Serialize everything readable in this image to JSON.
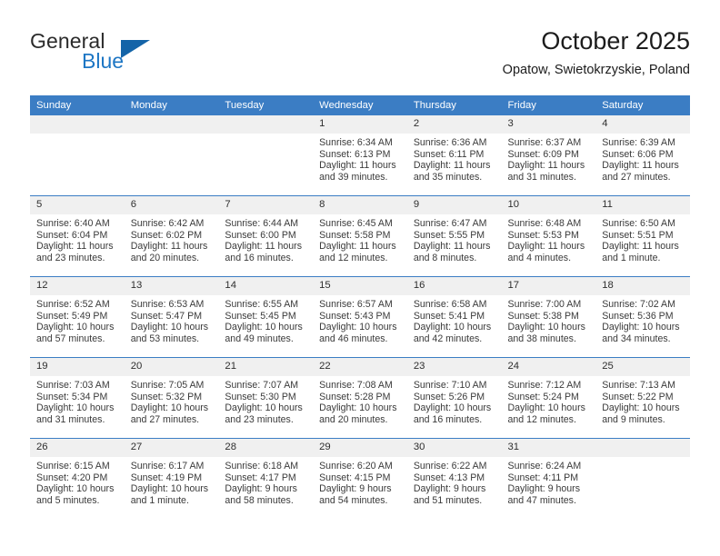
{
  "brand": {
    "name_part1": "General",
    "name_part2": "Blue",
    "accent_color": "#1d76c4",
    "logo_icon": "triangle-flag-icon"
  },
  "header": {
    "title": "October 2025",
    "location": "Opatow, Swietokrzyskie, Poland"
  },
  "calendar": {
    "header_bg": "#3b7dc4",
    "daynum_bg": "#f0f0f0",
    "weekday_headers": [
      "Sunday",
      "Monday",
      "Tuesday",
      "Wednesday",
      "Thursday",
      "Friday",
      "Saturday"
    ],
    "weeks": [
      [
        {
          "day": "",
          "empty": true
        },
        {
          "day": "",
          "empty": true
        },
        {
          "day": "",
          "empty": true
        },
        {
          "day": "1",
          "sunrise": "Sunrise: 6:34 AM",
          "sunset": "Sunset: 6:13 PM",
          "daylight1": "Daylight: 11 hours",
          "daylight2": "and 39 minutes."
        },
        {
          "day": "2",
          "sunrise": "Sunrise: 6:36 AM",
          "sunset": "Sunset: 6:11 PM",
          "daylight1": "Daylight: 11 hours",
          "daylight2": "and 35 minutes."
        },
        {
          "day": "3",
          "sunrise": "Sunrise: 6:37 AM",
          "sunset": "Sunset: 6:09 PM",
          "daylight1": "Daylight: 11 hours",
          "daylight2": "and 31 minutes."
        },
        {
          "day": "4",
          "sunrise": "Sunrise: 6:39 AM",
          "sunset": "Sunset: 6:06 PM",
          "daylight1": "Daylight: 11 hours",
          "daylight2": "and 27 minutes."
        }
      ],
      [
        {
          "day": "5",
          "sunrise": "Sunrise: 6:40 AM",
          "sunset": "Sunset: 6:04 PM",
          "daylight1": "Daylight: 11 hours",
          "daylight2": "and 23 minutes."
        },
        {
          "day": "6",
          "sunrise": "Sunrise: 6:42 AM",
          "sunset": "Sunset: 6:02 PM",
          "daylight1": "Daylight: 11 hours",
          "daylight2": "and 20 minutes."
        },
        {
          "day": "7",
          "sunrise": "Sunrise: 6:44 AM",
          "sunset": "Sunset: 6:00 PM",
          "daylight1": "Daylight: 11 hours",
          "daylight2": "and 16 minutes."
        },
        {
          "day": "8",
          "sunrise": "Sunrise: 6:45 AM",
          "sunset": "Sunset: 5:58 PM",
          "daylight1": "Daylight: 11 hours",
          "daylight2": "and 12 minutes."
        },
        {
          "day": "9",
          "sunrise": "Sunrise: 6:47 AM",
          "sunset": "Sunset: 5:55 PM",
          "daylight1": "Daylight: 11 hours",
          "daylight2": "and 8 minutes."
        },
        {
          "day": "10",
          "sunrise": "Sunrise: 6:48 AM",
          "sunset": "Sunset: 5:53 PM",
          "daylight1": "Daylight: 11 hours",
          "daylight2": "and 4 minutes."
        },
        {
          "day": "11",
          "sunrise": "Sunrise: 6:50 AM",
          "sunset": "Sunset: 5:51 PM",
          "daylight1": "Daylight: 11 hours",
          "daylight2": "and 1 minute."
        }
      ],
      [
        {
          "day": "12",
          "sunrise": "Sunrise: 6:52 AM",
          "sunset": "Sunset: 5:49 PM",
          "daylight1": "Daylight: 10 hours",
          "daylight2": "and 57 minutes."
        },
        {
          "day": "13",
          "sunrise": "Sunrise: 6:53 AM",
          "sunset": "Sunset: 5:47 PM",
          "daylight1": "Daylight: 10 hours",
          "daylight2": "and 53 minutes."
        },
        {
          "day": "14",
          "sunrise": "Sunrise: 6:55 AM",
          "sunset": "Sunset: 5:45 PM",
          "daylight1": "Daylight: 10 hours",
          "daylight2": "and 49 minutes."
        },
        {
          "day": "15",
          "sunrise": "Sunrise: 6:57 AM",
          "sunset": "Sunset: 5:43 PM",
          "daylight1": "Daylight: 10 hours",
          "daylight2": "and 46 minutes."
        },
        {
          "day": "16",
          "sunrise": "Sunrise: 6:58 AM",
          "sunset": "Sunset: 5:41 PM",
          "daylight1": "Daylight: 10 hours",
          "daylight2": "and 42 minutes."
        },
        {
          "day": "17",
          "sunrise": "Sunrise: 7:00 AM",
          "sunset": "Sunset: 5:38 PM",
          "daylight1": "Daylight: 10 hours",
          "daylight2": "and 38 minutes."
        },
        {
          "day": "18",
          "sunrise": "Sunrise: 7:02 AM",
          "sunset": "Sunset: 5:36 PM",
          "daylight1": "Daylight: 10 hours",
          "daylight2": "and 34 minutes."
        }
      ],
      [
        {
          "day": "19",
          "sunrise": "Sunrise: 7:03 AM",
          "sunset": "Sunset: 5:34 PM",
          "daylight1": "Daylight: 10 hours",
          "daylight2": "and 31 minutes."
        },
        {
          "day": "20",
          "sunrise": "Sunrise: 7:05 AM",
          "sunset": "Sunset: 5:32 PM",
          "daylight1": "Daylight: 10 hours",
          "daylight2": "and 27 minutes."
        },
        {
          "day": "21",
          "sunrise": "Sunrise: 7:07 AM",
          "sunset": "Sunset: 5:30 PM",
          "daylight1": "Daylight: 10 hours",
          "daylight2": "and 23 minutes."
        },
        {
          "day": "22",
          "sunrise": "Sunrise: 7:08 AM",
          "sunset": "Sunset: 5:28 PM",
          "daylight1": "Daylight: 10 hours",
          "daylight2": "and 20 minutes."
        },
        {
          "day": "23",
          "sunrise": "Sunrise: 7:10 AM",
          "sunset": "Sunset: 5:26 PM",
          "daylight1": "Daylight: 10 hours",
          "daylight2": "and 16 minutes."
        },
        {
          "day": "24",
          "sunrise": "Sunrise: 7:12 AM",
          "sunset": "Sunset: 5:24 PM",
          "daylight1": "Daylight: 10 hours",
          "daylight2": "and 12 minutes."
        },
        {
          "day": "25",
          "sunrise": "Sunrise: 7:13 AM",
          "sunset": "Sunset: 5:22 PM",
          "daylight1": "Daylight: 10 hours",
          "daylight2": "and 9 minutes."
        }
      ],
      [
        {
          "day": "26",
          "sunrise": "Sunrise: 6:15 AM",
          "sunset": "Sunset: 4:20 PM",
          "daylight1": "Daylight: 10 hours",
          "daylight2": "and 5 minutes."
        },
        {
          "day": "27",
          "sunrise": "Sunrise: 6:17 AM",
          "sunset": "Sunset: 4:19 PM",
          "daylight1": "Daylight: 10 hours",
          "daylight2": "and 1 minute."
        },
        {
          "day": "28",
          "sunrise": "Sunrise: 6:18 AM",
          "sunset": "Sunset: 4:17 PM",
          "daylight1": "Daylight: 9 hours",
          "daylight2": "and 58 minutes."
        },
        {
          "day": "29",
          "sunrise": "Sunrise: 6:20 AM",
          "sunset": "Sunset: 4:15 PM",
          "daylight1": "Daylight: 9 hours",
          "daylight2": "and 54 minutes."
        },
        {
          "day": "30",
          "sunrise": "Sunrise: 6:22 AM",
          "sunset": "Sunset: 4:13 PM",
          "daylight1": "Daylight: 9 hours",
          "daylight2": "and 51 minutes."
        },
        {
          "day": "31",
          "sunrise": "Sunrise: 6:24 AM",
          "sunset": "Sunset: 4:11 PM",
          "daylight1": "Daylight: 9 hours",
          "daylight2": "and 47 minutes."
        },
        {
          "day": "",
          "empty": true
        }
      ]
    ]
  }
}
